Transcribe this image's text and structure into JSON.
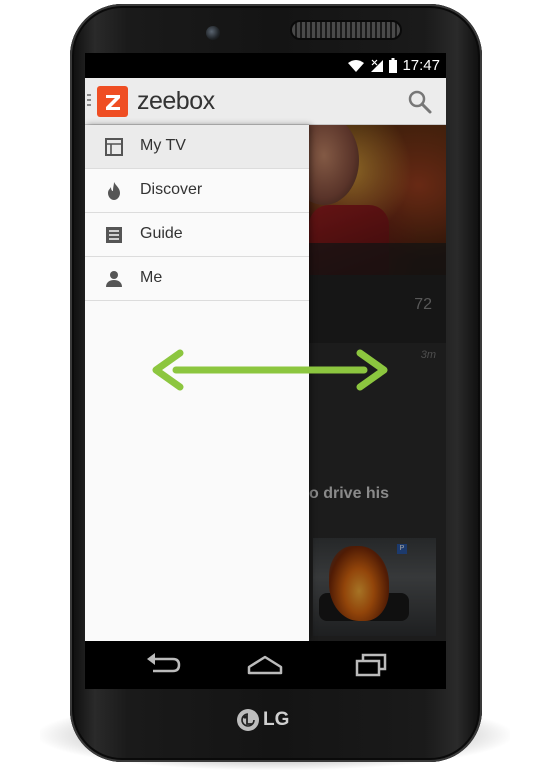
{
  "status_bar": {
    "time": "17:47"
  },
  "action_bar": {
    "app_name": "zeebox"
  },
  "drawer": {
    "items": [
      {
        "label": "My TV",
        "icon": "tv-icon",
        "selected": true
      },
      {
        "label": "Discover",
        "icon": "flame-icon",
        "selected": false
      },
      {
        "label": "Guide",
        "icon": "list-icon",
        "selected": false
      },
      {
        "label": "Me",
        "icon": "person-icon",
        "selected": false
      }
    ]
  },
  "content": {
    "hero_count": "72",
    "card_time": "3m",
    "card_headline": "o drive his"
  },
  "device": {
    "brand": "LG"
  },
  "colors": {
    "accent": "#ef4e23",
    "arrow": "#8cc63f",
    "action_bar": "#ececec",
    "drawer": "#fafafa"
  }
}
